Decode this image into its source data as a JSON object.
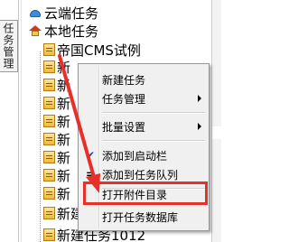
{
  "side_tab": {
    "label": "任务管理"
  },
  "tree": {
    "cloud_label": "云端任务",
    "local_label": "本地任务",
    "items": [
      {
        "label": "帝国CMS试例"
      },
      {
        "label": "新"
      },
      {
        "label": "新"
      },
      {
        "label": "新"
      },
      {
        "label": "新"
      },
      {
        "label": "新"
      },
      {
        "label": "新"
      },
      {
        "label": "新"
      },
      {
        "label": "新"
      },
      {
        "label": "新建任务1012"
      },
      {
        "label": "新建任务1012"
      }
    ]
  },
  "context_menu": {
    "items": [
      {
        "label": "新建任务"
      },
      {
        "label": "任务管理"
      },
      {
        "label": "批量设置"
      },
      {
        "label": "添加到启动栏"
      },
      {
        "label": "添加到任务队列"
      },
      {
        "label": "打开附件目录"
      },
      {
        "label": "打开任务数据库"
      }
    ]
  },
  "colors": {
    "highlight": "#e8302a",
    "check_mark": "#1a3fa8",
    "menu_bg": "#f0f0f0"
  },
  "icons": {
    "cloud": "cloud-icon",
    "home": "home-icon",
    "task": "task-page-icon"
  }
}
